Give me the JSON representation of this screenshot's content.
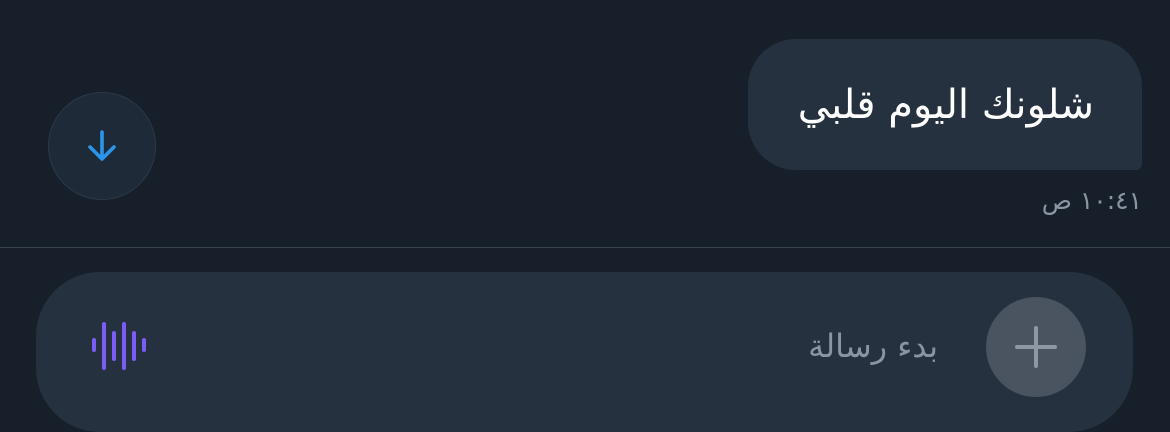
{
  "conversation": {
    "messages": [
      {
        "text": "شلونك اليوم قلبي",
        "time": "١٠:٤١ ص",
        "direction": "outgoing"
      }
    ],
    "scroll_down_icon": "arrow-down-icon"
  },
  "composer": {
    "placeholder": "بدء رسالة",
    "value": "",
    "voice_icon": "voice-waveform-icon",
    "attach_icon": "plus-icon"
  },
  "colors": {
    "background": "#17202a",
    "bubble": "#26313f",
    "accent_blue": "#2b95e9",
    "voice_purple": "#7b5cf5",
    "attach_button": "#4a5360",
    "muted_text": "#8b95a3"
  }
}
